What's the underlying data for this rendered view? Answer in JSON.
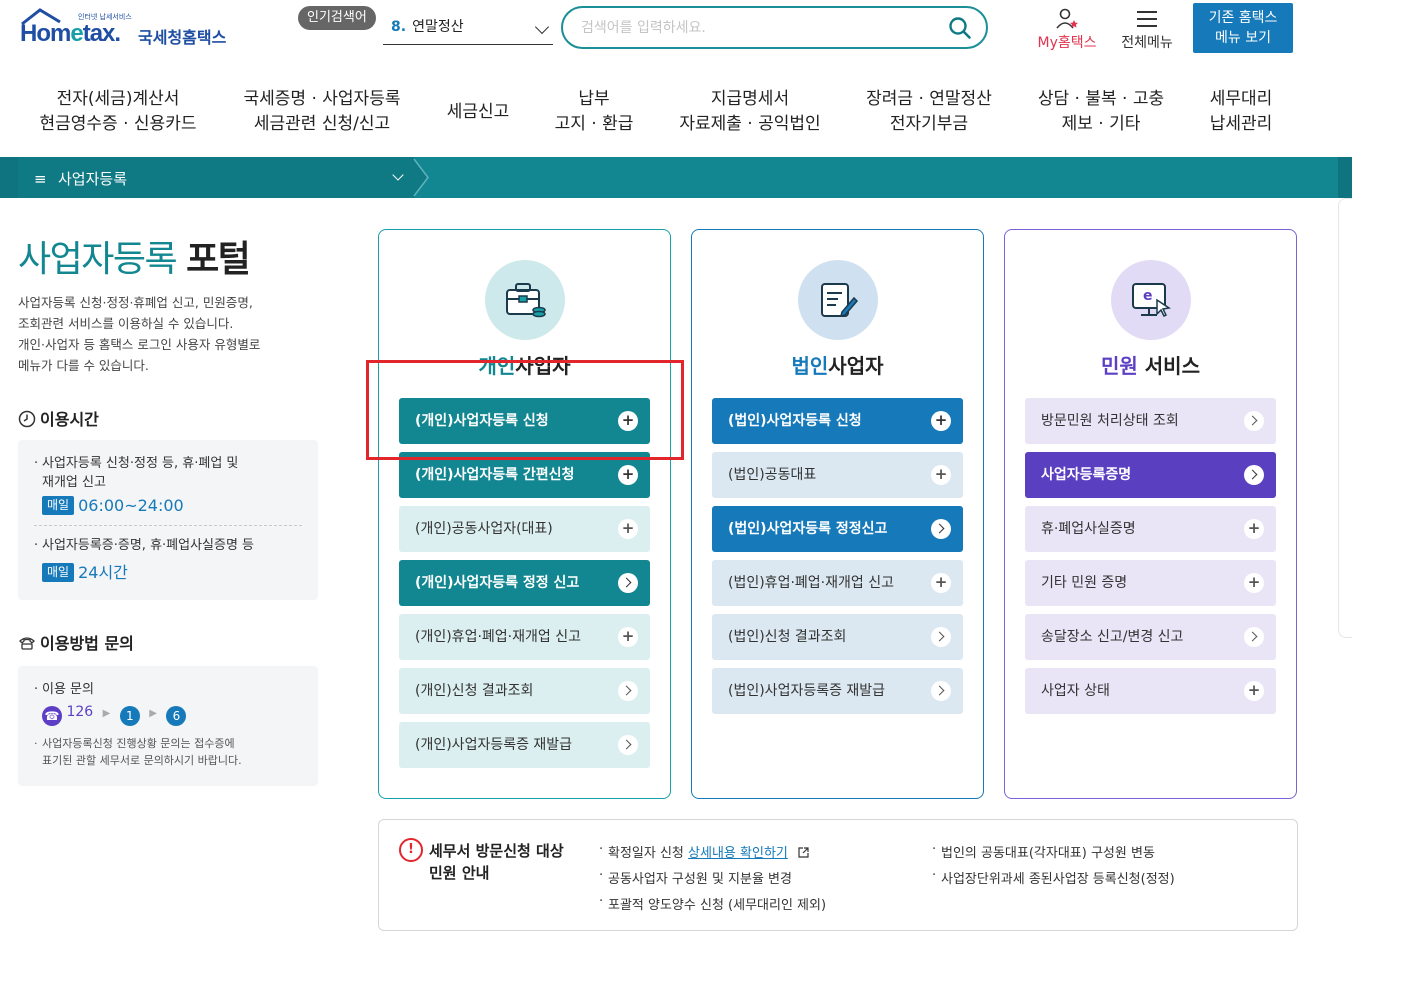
{
  "header": {
    "logo_tagline": "인터넷 납세서비스",
    "logo_text_left": "Hom",
    "logo_text_e": "e",
    "logo_text_right": "tax.",
    "logo_kor": "국세청홈택스",
    "hot_badge": "인기검색어",
    "hot_number": "8.",
    "hot_keyword": "연말정산",
    "search_placeholder": "검색어를 입력하세요.",
    "my_hometax": "My홈택스",
    "all_menu": "전체메뉴",
    "legacy_line1": "기존 홈택스",
    "legacy_line2": "메뉴 보기"
  },
  "gnb": [
    {
      "line1": "전자(세금)계산서",
      "line2": "현금영수증 · 신용카드"
    },
    {
      "line1": "국세증명 · 사업자등록",
      "line2": "세금관련 신청/신고"
    },
    {
      "line1": "세금신고",
      "line2": ""
    },
    {
      "line1": "납부",
      "line2": "고지 · 환급"
    },
    {
      "line1": "지급명세서",
      "line2": "자료제출 · 공익법인"
    },
    {
      "line1": "장려금 · 연말정산",
      "line2": "전자기부금"
    },
    {
      "line1": "상담 · 불복 · 고충",
      "line2": "제보 · 기타"
    },
    {
      "line1": "세무대리",
      "line2": "납세관리"
    }
  ],
  "location": {
    "menu_icon": "≡",
    "label": "사업자등록"
  },
  "left": {
    "title_part1": "사업자등록",
    "title_part2": "포털",
    "desc_line1": "사업자등록 신청·정정·휴폐업 신고, 민원증명,",
    "desc_line2": "조회관련 서비스를 이용하실 수 있습니다.",
    "desc_line3": "개인·사업자 등 홈택스 로그인 사용자 유형별로",
    "desc_line4": "메뉴가 다를 수 있습니다.",
    "hours_title": "이용시간",
    "hours_item1_line1": "사업자등록 신청·정정 등, 휴·폐업 및",
    "hours_item1_line2": "재개업 신고",
    "hours_badge": "매일",
    "hours_item1_time": "06:00~24:00",
    "hours_item2": "사업자등록증·증명, 휴·폐업사실증명 등",
    "hours_item2_time": "24시간",
    "inquiry_title": "이용방법 문의",
    "inquiry_item": "이용 문의",
    "phone_number": "126",
    "phone_step1": "1",
    "phone_step2": "6",
    "inquiry_note_line1": "사업자등록신청 진행상황 문의는 접수증에",
    "inquiry_note_line2": "표기된 관할 세무서로 문의하시기 바랍니다."
  },
  "cards": {
    "individual": {
      "title_hl": "개인",
      "title_rest": "사업자",
      "buttons": [
        {
          "label": "(개인)사업자등록 신청",
          "icon": "+"
        },
        {
          "label": "(개인)사업자등록 간편신청",
          "icon": "+"
        },
        {
          "label": "(개인)공동사업자(대표)",
          "icon": "+"
        },
        {
          "label": "(개인)사업자등록 정정 신고",
          "icon": ">"
        },
        {
          "label": "(개인)휴업·폐업·재개업 신고",
          "icon": "+"
        },
        {
          "label": "(개인)신청 결과조회",
          "icon": ">"
        },
        {
          "label": "(개인)사업자등록증 재발급",
          "icon": ">"
        }
      ]
    },
    "corporate": {
      "title_hl": "법인",
      "title_rest": "사업자",
      "buttons": [
        {
          "label": "(법인)사업자등록 신청",
          "icon": "+"
        },
        {
          "label": "(법인)공동대표",
          "icon": "+"
        },
        {
          "label": "(법인)사업자등록 정정신고",
          "icon": ">"
        },
        {
          "label": "(법인)휴업·폐업·재개업 신고",
          "icon": "+"
        },
        {
          "label": "(법인)신청 결과조회",
          "icon": ">"
        },
        {
          "label": "(법인)사업자등록증 재발급",
          "icon": ">"
        }
      ]
    },
    "civil": {
      "title_hl": "민원",
      "title_rest": " 서비스",
      "buttons": [
        {
          "label": "방문민원 처리상태 조회",
          "icon": ">"
        },
        {
          "label": "사업자등록증명",
          "icon": ">"
        },
        {
          "label": "휴·폐업사실증명",
          "icon": "+"
        },
        {
          "label": "기타 민원 증명",
          "icon": "+"
        },
        {
          "label": "송달장소 신고/변경 신고",
          "icon": ">"
        },
        {
          "label": "사업자 상태",
          "icon": "+"
        }
      ]
    }
  },
  "notice": {
    "icon": "!",
    "title_line1": "세무서 방문신청 대상",
    "title_line2": "민원 안내",
    "item1_text": "확정일자 신청",
    "item1_link": "상세내용 확인하기",
    "item2": "공동사업자 구성원 및 지분율 변경",
    "item3": "포괄적 양도양수 신청 (세무대리인 제외)",
    "item4": "법인의 공동대표(각자대표) 구성원 변동",
    "item5": "사업장단위과세 종된사업장 등록신청(정정)"
  },
  "colors": {
    "teal": "#128791",
    "blue": "#1679b9",
    "purple": "#5a3fc0",
    "highlight": "#e2262c"
  }
}
